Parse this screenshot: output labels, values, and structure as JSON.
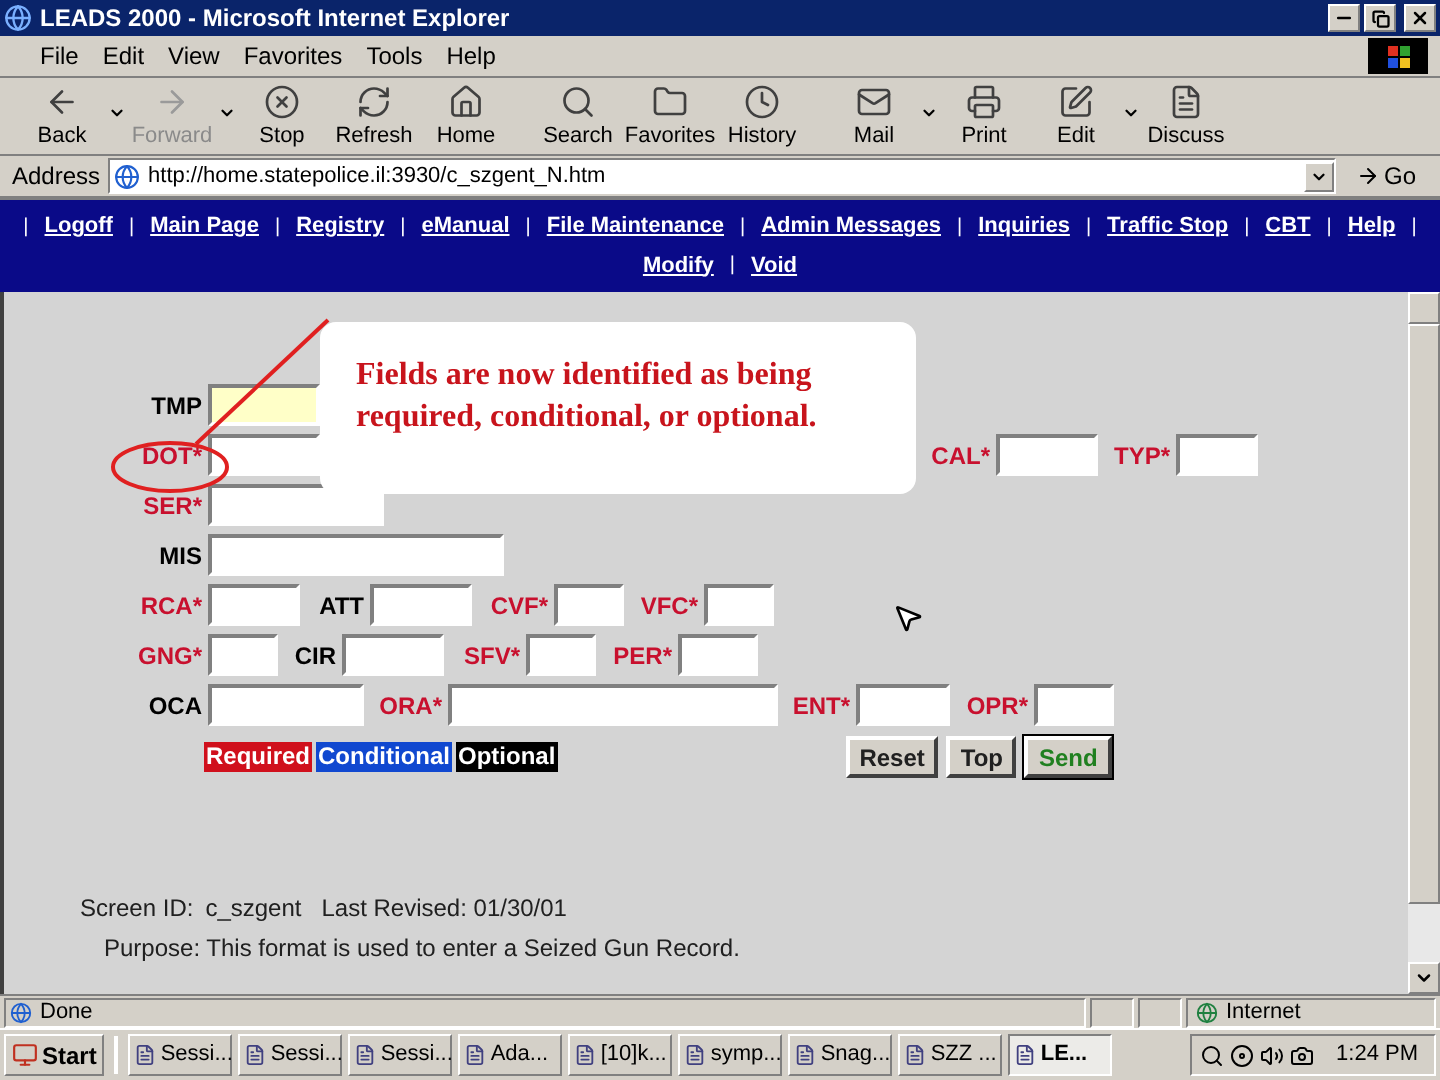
{
  "window": {
    "title": "LEADS 2000 - Microsoft Internet Explorer"
  },
  "menu": [
    "File",
    "Edit",
    "View",
    "Favorites",
    "Tools",
    "Help"
  ],
  "toolbar": [
    {
      "label": "Back",
      "disabled": false,
      "dropdown": true
    },
    {
      "label": "Forward",
      "disabled": true,
      "dropdown": true
    },
    {
      "label": "Stop",
      "disabled": false,
      "dropdown": false
    },
    {
      "label": "Refresh",
      "disabled": false,
      "dropdown": false
    },
    {
      "label": "Home",
      "disabled": false,
      "dropdown": false
    },
    {
      "label": "Search",
      "disabled": false,
      "dropdown": false
    },
    {
      "label": "Favorites",
      "disabled": false,
      "dropdown": false
    },
    {
      "label": "History",
      "disabled": false,
      "dropdown": false
    },
    {
      "label": "Mail",
      "disabled": false,
      "dropdown": true
    },
    {
      "label": "Print",
      "disabled": false,
      "dropdown": false
    },
    {
      "label": "Edit",
      "disabled": false,
      "dropdown": true
    },
    {
      "label": "Discuss",
      "disabled": false,
      "dropdown": false
    }
  ],
  "address": {
    "label": "Address",
    "value": "http://home.statepolice.il:3930/c_szgent_N.htm",
    "go": "Go"
  },
  "nav": [
    [
      {
        "kind": "separator",
        "text": "|"
      },
      {
        "kind": "link",
        "text": "Logoff"
      },
      {
        "kind": "separator",
        "text": "|"
      },
      {
        "kind": "link",
        "text": "Main Page"
      },
      {
        "kind": "separator",
        "text": "|"
      },
      {
        "kind": "link",
        "text": "Registry"
      },
      {
        "kind": "separator",
        "text": "|"
      },
      {
        "kind": "link",
        "text": "eManual"
      },
      {
        "kind": "separator",
        "text": "|"
      },
      {
        "kind": "link",
        "text": "File Maintenance"
      },
      {
        "kind": "separator",
        "text": "|"
      },
      {
        "kind": "link",
        "text": "Admin Messages"
      },
      {
        "kind": "separator",
        "text": "|"
      },
      {
        "kind": "link",
        "text": "Inquiries"
      },
      {
        "kind": "separator",
        "text": "|"
      },
      {
        "kind": "link",
        "text": "Traffic Stop"
      },
      {
        "kind": "separator",
        "text": "|"
      },
      {
        "kind": "link",
        "text": "CBT"
      },
      {
        "kind": "separator",
        "text": "|"
      },
      {
        "kind": "link",
        "text": "Help"
      },
      {
        "kind": "separator",
        "text": "|"
      }
    ],
    [
      {
        "kind": "link",
        "text": "Modify"
      },
      {
        "kind": "separator",
        "text": "|"
      },
      {
        "kind": "link",
        "text": "Void"
      }
    ]
  ],
  "form": {
    "rows": [
      [
        {
          "label": "TMP",
          "kind": "optional",
          "highlighted": true
        }
      ],
      [
        {
          "label": "DOT*",
          "kind": "required",
          "highlighted": false
        },
        {
          "label": "CAL*",
          "kind": "required",
          "highlighted": false
        },
        {
          "label": "TYP*",
          "kind": "required",
          "highlighted": false
        }
      ],
      [
        {
          "label": "SER*",
          "kind": "required",
          "highlighted": false
        }
      ],
      [
        {
          "label": "MIS",
          "kind": "optional",
          "highlighted": false
        }
      ],
      [
        {
          "label": "RCA*",
          "kind": "required",
          "highlighted": false
        },
        {
          "label": "ATT",
          "kind": "optional",
          "highlighted": false
        },
        {
          "label": "CVF*",
          "kind": "required",
          "highlighted": false
        },
        {
          "label": "VFC*",
          "kind": "required",
          "highlighted": false
        }
      ],
      [
        {
          "label": "GNG*",
          "kind": "required",
          "highlighted": false
        },
        {
          "label": "CIR",
          "kind": "optional",
          "highlighted": false
        },
        {
          "label": "SFV*",
          "kind": "required",
          "highlighted": false
        },
        {
          "label": "PER*",
          "kind": "required",
          "highlighted": false
        }
      ],
      [
        {
          "label": "OCA",
          "kind": "optional",
          "highlighted": false
        },
        {
          "label": "ORA*",
          "kind": "required",
          "highlighted": false
        },
        {
          "label": "ENT*",
          "kind": "required",
          "highlighted": false
        },
        {
          "label": "OPR*",
          "kind": "required",
          "highlighted": false
        }
      ]
    ],
    "legend": [
      {
        "kind": "required",
        "text": "Required"
      },
      {
        "kind": "conditional",
        "text": "Conditional"
      },
      {
        "kind": "optional",
        "text": "Optional"
      }
    ],
    "buttons": [
      {
        "label": "Reset",
        "kind": "plain"
      },
      {
        "label": "Top",
        "kind": "plain"
      },
      {
        "label": "Send",
        "kind": "send"
      }
    ]
  },
  "callout": {
    "text": "Fields are now identified as being required, conditional, or optional."
  },
  "footer": {
    "screen_id": "Screen ID:",
    "screen_value": "c_szgent",
    "revised": "Last Revised: 01/30/01",
    "purpose": "Purpose: This format is used to enter a Seized Gun Record."
  },
  "status_bar": {
    "text": "Done",
    "zone": "Internet"
  },
  "taskbar": {
    "start": "Start",
    "tasks": [
      {
        "label": "Sessi...",
        "selected": false
      },
      {
        "label": "Sessi...",
        "selected": false
      },
      {
        "label": "Sessi...",
        "selected": false
      },
      {
        "label": "Ada...",
        "selected": false
      },
      {
        "label": "[10]k...",
        "selected": false
      },
      {
        "label": "symp...",
        "selected": false
      },
      {
        "label": "Snag...",
        "selected": false
      },
      {
        "label": "SZZ ...",
        "selected": false
      },
      {
        "label": "LE...",
        "selected": true
      }
    ],
    "clock": "1:24 PM"
  }
}
